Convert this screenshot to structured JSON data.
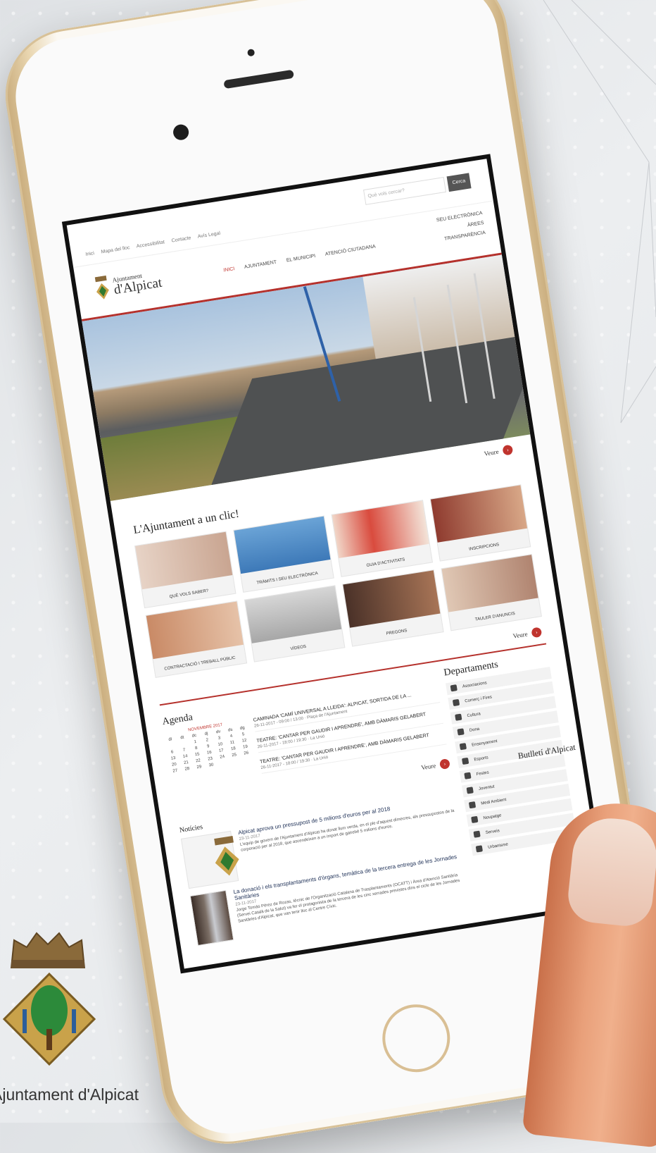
{
  "site": {
    "search_placeholder": "Què vols cercar?",
    "search_button": "Cerca",
    "utility_links": [
      "Inici",
      "Mapa del lloc",
      "Accessibilitat",
      "Contacte",
      "Avís Legal"
    ],
    "logo_line1": "Ajuntament",
    "logo_line2": "d'Alpicat",
    "nav": [
      "INICI",
      "AJUNTAMENT",
      "EL MUNICIPI",
      "ATENCIÓ CIUTADANA"
    ],
    "nav_right": [
      "SEU ELECTRÒNICA",
      "ÀREES",
      "TRANSPARÈNCIA"
    ],
    "veure": "Veure",
    "clic_title": "L'Ajuntament a un clic!",
    "tiles": [
      "QUÈ VOLS SABER?",
      "TRÀMITS I SEU ELECTRÒNICA",
      "GUIA D'ACTIVITATS",
      "INSCRIPCIONS",
      "CONTRACTACIÓ I TREBALL PÚBLIC",
      "VÍDEOS",
      "PREGONS",
      "TAULER D'ANUNCIS"
    ],
    "agenda_title": "Agenda",
    "calendar_month": "NOVEMBRE 2017",
    "calendar_days": [
      "dl",
      "dt",
      "dc",
      "dj",
      "dv",
      "ds",
      "dg",
      "",
      "",
      "1",
      "2",
      "3",
      "4",
      "5",
      "6",
      "7",
      "8",
      "9",
      "10",
      "11",
      "12",
      "13",
      "14",
      "15",
      "16",
      "17",
      "18",
      "19",
      "20",
      "21",
      "22",
      "23",
      "24",
      "25",
      "26",
      "27",
      "28",
      "29",
      "30",
      "",
      ""
    ],
    "events": [
      {
        "title": "CAMINADA 'CAMÍ UNIVERSAL A LLEIDA': ALPICAT, SORTIDA DE LA ...",
        "meta": "26-11-2017 - 09:00 / 13:00 · Plaça de l'Ajuntament"
      },
      {
        "title": "TEATRE: 'CANTAR PER GAUDIR I APRENDRE', AMB DÀMARIS GELABERT",
        "meta": "26-11-2017 - 18:00 / 19:30 · La Unió"
      },
      {
        "title": "TEATRE: 'CANTAR PER GAUDIR I APRENDRE', AMB DÀMARIS GELABERT",
        "meta": "26-11-2017 - 18:00 / 19:30 · La Unió"
      }
    ],
    "departaments_title": "Departaments",
    "departaments": [
      "Associacions",
      "Comerç i Fires",
      "Cultura",
      "Dona",
      "Ensenyament",
      "Esports",
      "Festes",
      "Joventut",
      "Medi Ambient",
      "Noupatge",
      "Serveis",
      "Urbanisme"
    ],
    "noticies_title": "Notícies",
    "news": [
      {
        "title": "Alpicat aprova un pressupost de 5 milions d'euros per al 2018",
        "date": "23-11-2017",
        "text": "L'equip de govern de l'Ajuntament d'Alpicat ha donat llum verda, en el ple d'aquest dimecres, als pressupostos de la corporació per al 2018, que ascendeixen a un import de gairebé 5 milions d'euros."
      },
      {
        "title": "La donació i els transplantaments d'òrgans, temàtica de la tercera entrega de les Jornades Sanitàries",
        "date": "23-11-2017",
        "text": "Jorge Tomás Pérez de Rozas, tècnic de l'Organització Catalana de Trasplantaments (OCATT) i Àrea d'Atenció Sanitària (Servei Català de la Salut) va fer el protagonista de la tercera de les cinc xerrades previstes dins el cicle de les Jornades Sanitàries d'Alpicat, que van tenir lloc al Centre Cívic."
      }
    ],
    "butlleti": "Butlletí d'Alpicat"
  },
  "brand_name": "Ajuntament d'Alpicat",
  "colors": {
    "accent": "#b5312c",
    "gold": "#d9bf94"
  }
}
